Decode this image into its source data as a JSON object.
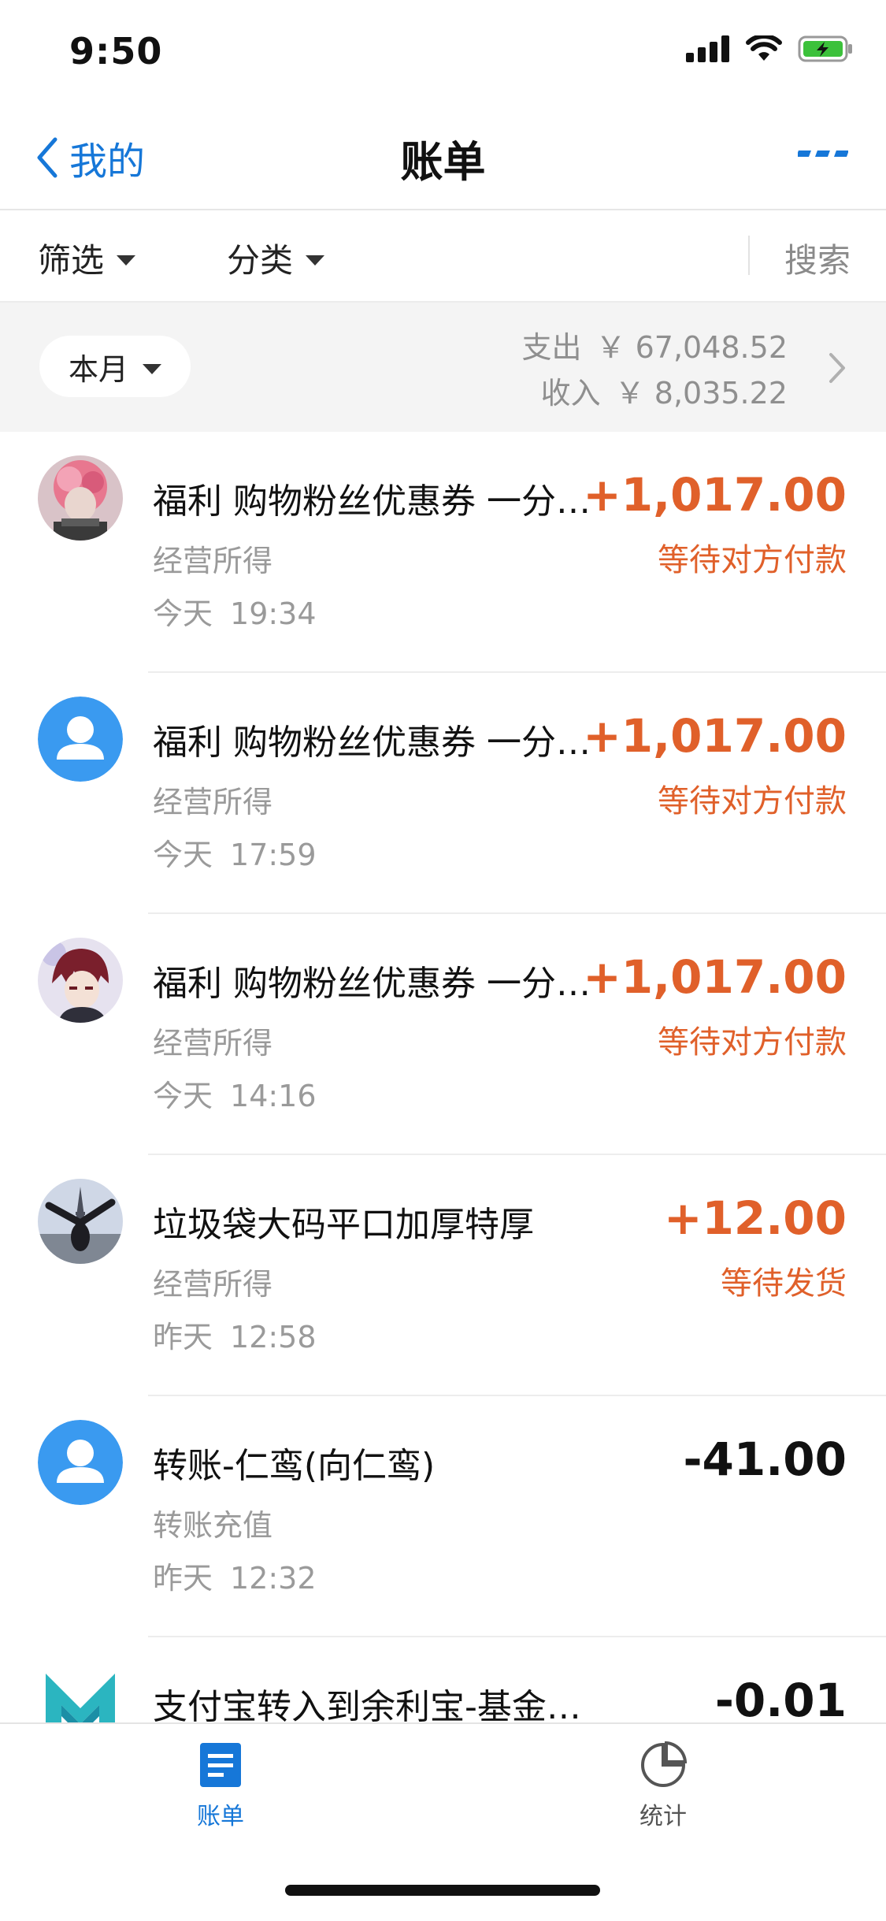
{
  "status_bar": {
    "time": "9:50"
  },
  "nav": {
    "back_label": "我的",
    "title": "账单"
  },
  "filters": {
    "filter_label": "筛选",
    "category_label": "分类",
    "search_label": "搜索"
  },
  "month": {
    "selector_label": "本月",
    "expense_label": "支出",
    "expense_value": "￥ 67,048.52",
    "income_label": "收入",
    "income_value": "￥ 8,035.22"
  },
  "transactions": [
    {
      "title": "福利 购物粉丝优惠券 一分钱...",
      "category": "经营所得",
      "day": "今天",
      "time": "19:34",
      "amount": "+1,017.00",
      "status": "等待对方付款",
      "avatar": "pink-photo"
    },
    {
      "title": "福利 购物粉丝优惠券 一分钱...",
      "category": "经营所得",
      "day": "今天",
      "time": "17:59",
      "amount": "+1,017.00",
      "status": "等待对方付款",
      "avatar": "default-user"
    },
    {
      "title": "福利 购物粉丝优惠券 一分钱...",
      "category": "经营所得",
      "day": "今天",
      "time": "14:16",
      "amount": "+1,017.00",
      "status": "等待对方付款",
      "avatar": "anime-photo"
    },
    {
      "title": "垃圾袋大码平口加厚特厚",
      "category": "经营所得",
      "day": "昨天",
      "time": "12:58",
      "amount": "+12.00",
      "status": "等待发货",
      "avatar": "tower-photo"
    },
    {
      "title": "转账-仁鸾(向仁鸾)",
      "category": "转账充值",
      "day": "昨天",
      "time": "12:32",
      "amount": "-41.00",
      "status": "",
      "avatar": "default-user"
    },
    {
      "title": "支付宝转入到余利宝-基金申购",
      "category": "",
      "day": "",
      "time": "",
      "amount": "-0.01",
      "status": "",
      "avatar": "mybank-logo"
    }
  ],
  "tabbar": {
    "bills_label": "账单",
    "stats_label": "统计"
  },
  "colors": {
    "accent": "#1677d8",
    "income": "#e0602a",
    "muted": "#9a9a9a"
  }
}
